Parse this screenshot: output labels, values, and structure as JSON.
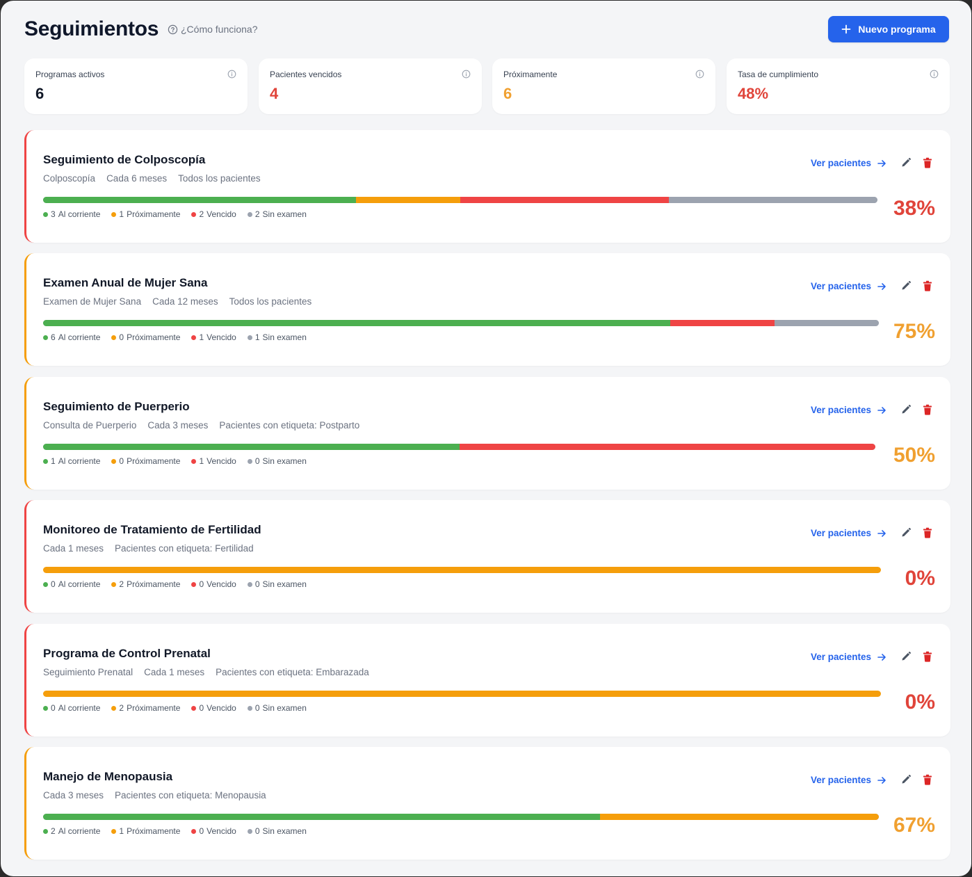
{
  "header": {
    "title": "Seguimientos",
    "help_label": "¿Cómo funciona?",
    "new_button_label": "Nuevo programa"
  },
  "colors": {
    "al_corriente": "#4caf50",
    "proximamente": "#f59e0b",
    "vencido": "#ef4444",
    "sin_examen": "#9ca3af",
    "accent": "#2563eb",
    "pct_red": "#e0443a",
    "pct_orange": "#f0a030"
  },
  "stats": [
    {
      "label": "Programas activos",
      "value": "6",
      "color": "#111827"
    },
    {
      "label": "Pacientes vencidos",
      "value": "4",
      "color": "#e0443a"
    },
    {
      "label": "Próximamente",
      "value": "6",
      "color": "#f0a030"
    },
    {
      "label": "Tasa de cumplimiento",
      "value": "48%",
      "color": "#e0443a"
    }
  ],
  "legend_labels": {
    "al_corriente": "Al corriente",
    "proximamente": "Próximamente",
    "vencido": "Vencido",
    "sin_examen": "Sin examen"
  },
  "actions": {
    "ver_pacientes": "Ver pacientes"
  },
  "programs": [
    {
      "title": "Seguimiento de Colposcopía",
      "meta": [
        "Colposcopía",
        "Cada 6 meses",
        "Todos los pacientes"
      ],
      "counts": {
        "al_corriente": 3,
        "proximamente": 1,
        "vencido": 2,
        "sin_examen": 2
      },
      "percent": "38%",
      "status": "red"
    },
    {
      "title": "Examen Anual de Mujer Sana",
      "meta": [
        "Examen de Mujer Sana",
        "Cada 12 meses",
        "Todos los pacientes"
      ],
      "counts": {
        "al_corriente": 6,
        "proximamente": 0,
        "vencido": 1,
        "sin_examen": 1
      },
      "percent": "75%",
      "status": "orange"
    },
    {
      "title": "Seguimiento de Puerperio",
      "meta": [
        "Consulta de Puerperio",
        "Cada 3 meses",
        "Pacientes con etiqueta: Postparto"
      ],
      "counts": {
        "al_corriente": 1,
        "proximamente": 0,
        "vencido": 1,
        "sin_examen": 0
      },
      "percent": "50%",
      "status": "orange"
    },
    {
      "title": "Monitoreo de Tratamiento de Fertilidad",
      "meta": [
        "Cada 1 meses",
        "Pacientes con etiqueta: Fertilidad"
      ],
      "counts": {
        "al_corriente": 0,
        "proximamente": 2,
        "vencido": 0,
        "sin_examen": 0
      },
      "percent": "0%",
      "status": "red"
    },
    {
      "title": "Programa de Control Prenatal",
      "meta": [
        "Seguimiento Prenatal",
        "Cada 1 meses",
        "Pacientes con etiqueta: Embarazada"
      ],
      "counts": {
        "al_corriente": 0,
        "proximamente": 2,
        "vencido": 0,
        "sin_examen": 0
      },
      "percent": "0%",
      "status": "red"
    },
    {
      "title": "Manejo de Menopausia",
      "meta": [
        "Cada 3 meses",
        "Pacientes con etiqueta: Menopausia"
      ],
      "counts": {
        "al_corriente": 2,
        "proximamente": 1,
        "vencido": 0,
        "sin_examen": 0
      },
      "percent": "67%",
      "status": "orange"
    }
  ]
}
